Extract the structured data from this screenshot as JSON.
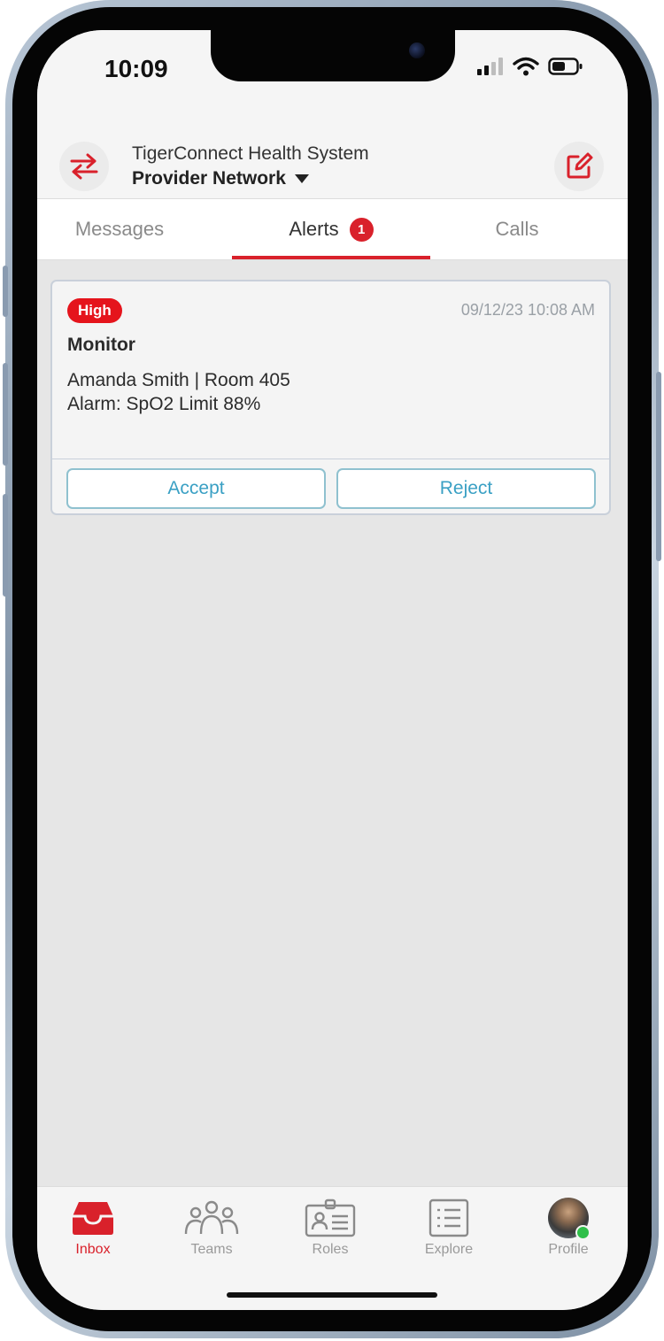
{
  "status_bar": {
    "time": "10:09",
    "icons": [
      "signal-icon",
      "wifi-icon",
      "battery-icon"
    ]
  },
  "header": {
    "org_name": "TigerConnect Health System",
    "network_name": "Provider Network",
    "switch_icon": "switch-arrows-icon",
    "compose_icon": "compose-icon"
  },
  "tabs": [
    {
      "label": "Messages",
      "active": false
    },
    {
      "label": "Alerts",
      "active": true,
      "badge": "1"
    },
    {
      "label": "Calls",
      "active": false
    }
  ],
  "alert": {
    "priority": "High",
    "timestamp": "09/12/23 10:08 AM",
    "title": "Monitor",
    "line1": "Amanda Smith | Room 405",
    "line2": "Alarm: SpO2 Limit 88%",
    "accept_label": "Accept",
    "reject_label": "Reject"
  },
  "bottom_nav": [
    {
      "label": "Inbox",
      "icon": "inbox-icon",
      "active": true
    },
    {
      "label": "Teams",
      "icon": "teams-icon",
      "active": false
    },
    {
      "label": "Roles",
      "icon": "roles-icon",
      "active": false
    },
    {
      "label": "Explore",
      "icon": "explore-icon",
      "active": false
    },
    {
      "label": "Profile",
      "icon": "avatar",
      "active": false
    }
  ],
  "colors": {
    "accent_red": "#d9212b",
    "button_teal": "#3aa0c4",
    "presence_green": "#2fbf4a"
  }
}
